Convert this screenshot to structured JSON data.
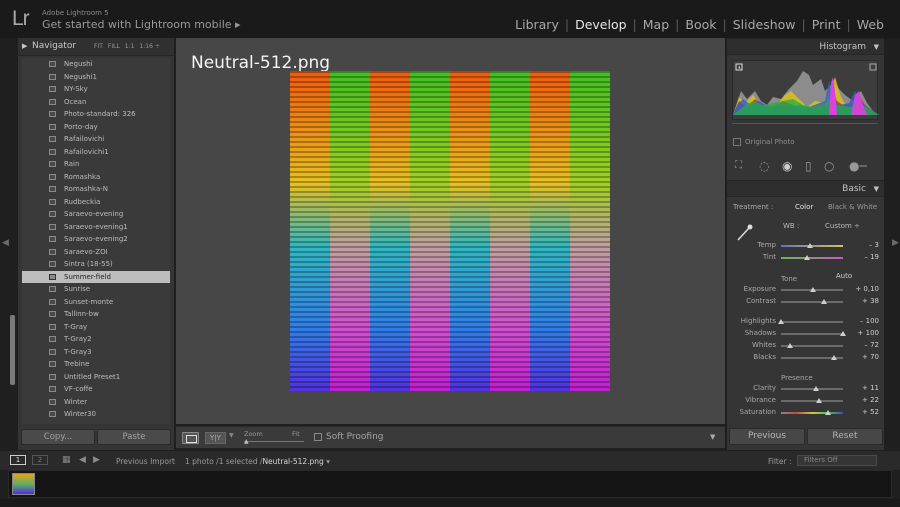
{
  "app": {
    "name": "Adobe Lightroom 5",
    "logo": "Lr",
    "get_started": "Get started with Lightroom mobile",
    "get_started_arrow": "▸",
    "modules": [
      "Library",
      "Develop",
      "Map",
      "Book",
      "Slideshow",
      "Print",
      "Web"
    ],
    "active_module": "Develop"
  },
  "navigator": {
    "title": "Navigator",
    "zoom_options": [
      "FIT",
      "FILL",
      "1:1",
      "1:16 ÷"
    ]
  },
  "presets": [
    "Negushi",
    "Negushi1",
    "NY-Sky",
    "Ocean",
    "Photo-standard: 326",
    "Porto-day",
    "Rafailovichi",
    "Rafailovichi1",
    "Rain",
    "Romashka",
    "Romashka-N",
    "Rudbeckia",
    "Saraevo-evening",
    "Saraevo-evening1",
    "Saraevo-evening2",
    "Saraevo-ZOI",
    "Sintra (18-55)",
    "Summer-field",
    "Sunrise",
    "Sunset-monte",
    "Tallinn-bw",
    "T-Gray",
    "T-Gray2",
    "T-Gray3",
    "Trebine",
    "Untitled Preset1",
    "VF-coffe",
    "Winter",
    "Winter30"
  ],
  "selected_preset": "Summer-field",
  "left_buttons": {
    "copy": "Copy...",
    "paste": "Paste"
  },
  "image": {
    "title": "Neutral-512.png"
  },
  "toolbar": {
    "yy": "Y|Y",
    "zoom_label": "Zoom",
    "fit_label": "Fit",
    "soft_proofing": "Soft Proofing"
  },
  "histogram": {
    "title": "Histogram",
    "original_photo": "Original Photo"
  },
  "basic": {
    "title": "Basic",
    "treatment_label": "Treatment :",
    "treatment_color": "Color",
    "treatment_bw": "Black & White",
    "wb_label": "WB :",
    "wb_value": "Custom ÷",
    "tone_label": "Tone",
    "auto_label": "Auto",
    "presence_label": "Presence",
    "sliders": [
      {
        "label": "Temp",
        "value": "– 3",
        "pos": 0.46,
        "grad": "linear-gradient(90deg,#5a7ab8,#d8c058)"
      },
      {
        "label": "Tint",
        "value": "– 19",
        "pos": 0.42,
        "grad": "linear-gradient(90deg,#6ab85a,#c85ac0)"
      },
      {
        "label": "Exposure",
        "value": "+ 0,10",
        "pos": 0.51,
        "grad": ""
      },
      {
        "label": "Contrast",
        "value": "+ 38",
        "pos": 0.69,
        "grad": ""
      },
      {
        "label": "Highlights",
        "value": "– 100",
        "pos": 0.0,
        "grad": ""
      },
      {
        "label": "Shadows",
        "value": "+ 100",
        "pos": 1.0,
        "grad": ""
      },
      {
        "label": "Whites",
        "value": "– 72",
        "pos": 0.14,
        "grad": ""
      },
      {
        "label": "Blacks",
        "value": "+ 70",
        "pos": 0.85,
        "grad": ""
      },
      {
        "label": "Clarity",
        "value": "+ 11",
        "pos": 0.56,
        "grad": ""
      },
      {
        "label": "Vibrance",
        "value": "+ 22",
        "pos": 0.61,
        "grad": ""
      },
      {
        "label": "Saturation",
        "value": "+ 52",
        "pos": 0.76,
        "grad": "linear-gradient(90deg,#888,#c84848,#c8c848,#48c848,#4848c8)"
      }
    ]
  },
  "right_buttons": {
    "previous": "Previous",
    "reset": "Reset"
  },
  "filmstrip": {
    "screen1": "1",
    "screen2": "2",
    "previous_import": "Previous Import",
    "photo_count": "1 photo /1 selected /",
    "filename": "Neutral-512.png",
    "filename_caret": "▾",
    "filter_label": "Filter :",
    "filter_value": "Filters Off"
  },
  "colors": {
    "accent": "#e8e8e8",
    "panel": "#353535",
    "center": "#474747"
  }
}
